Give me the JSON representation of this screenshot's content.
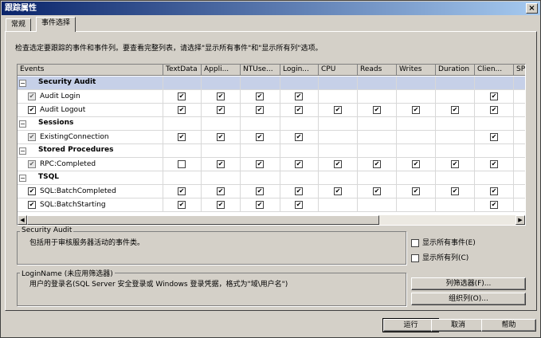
{
  "window": {
    "title": "跟踪属性"
  },
  "tabs": [
    {
      "label": "常规"
    },
    {
      "label": "事件选择"
    }
  ],
  "instructions": "检查选定要跟踪的事件和事件列。要查看完整列表，请选择\"显示所有事件\"和\"显示所有列\"选项。",
  "grid": {
    "columns": [
      {
        "label": "Events"
      },
      {
        "label": "TextData"
      },
      {
        "label": "Appli..."
      },
      {
        "label": "NTUse..."
      },
      {
        "label": "Login..."
      },
      {
        "label": "CPU"
      },
      {
        "label": "Reads"
      },
      {
        "label": "Writes"
      },
      {
        "label": "Duration"
      },
      {
        "label": "Clien..."
      },
      {
        "label": "SP"
      }
    ],
    "rows": [
      {
        "kind": "category",
        "label": "Security Audit",
        "toggle": "−",
        "selected": true
      },
      {
        "kind": "event",
        "label": "Audit Login",
        "grey": true,
        "checks": [
          1,
          1,
          1,
          1,
          0,
          0,
          0,
          0,
          1
        ]
      },
      {
        "kind": "event",
        "label": "Audit Logout",
        "grey": false,
        "checks": [
          1,
          1,
          1,
          1,
          1,
          1,
          1,
          1,
          1
        ]
      },
      {
        "kind": "category",
        "label": "Sessions",
        "toggle": "−"
      },
      {
        "kind": "event",
        "label": "ExistingConnection",
        "grey": true,
        "checks": [
          1,
          1,
          1,
          1,
          0,
          0,
          0,
          0,
          1
        ]
      },
      {
        "kind": "category",
        "label": "Stored Procedures",
        "toggle": "−"
      },
      {
        "kind": "event",
        "label": "RPC:Completed",
        "grey": true,
        "checks": [
          0,
          1,
          1,
          1,
          1,
          1,
          1,
          1,
          1
        ]
      },
      {
        "kind": "category",
        "label": "TSQL",
        "toggle": "−"
      },
      {
        "kind": "event",
        "label": "SQL:BatchCompleted",
        "grey": false,
        "checks": [
          1,
          1,
          1,
          1,
          1,
          1,
          1,
          1,
          1
        ]
      },
      {
        "kind": "event",
        "label": "SQL:BatchStarting",
        "grey": false,
        "checks": [
          1,
          1,
          1,
          1,
          0,
          0,
          0,
          0,
          1
        ]
      }
    ],
    "check_glyph": "✔"
  },
  "desc_event": {
    "title": "Security Audit",
    "text": "包括用于审核服务器活动的事件类。"
  },
  "desc_column": {
    "title": "LoginName (未应用筛选器)",
    "text": "用户的登录名(SQL Server 安全登录或 Windows 登录凭据，格式为\"域\\用户名\")"
  },
  "options": {
    "show_all_events": "显示所有事件(E)",
    "show_all_columns": "显示所有列(C)"
  },
  "buttons": {
    "column_filters": "列筛选器(F)...",
    "organize_columns": "组织列(O)...",
    "run": "运行",
    "cancel": "取消",
    "help": "帮助"
  },
  "scroll": {
    "left_arrow": "◀",
    "right_arrow": "▶"
  },
  "close_glyph": "×"
}
